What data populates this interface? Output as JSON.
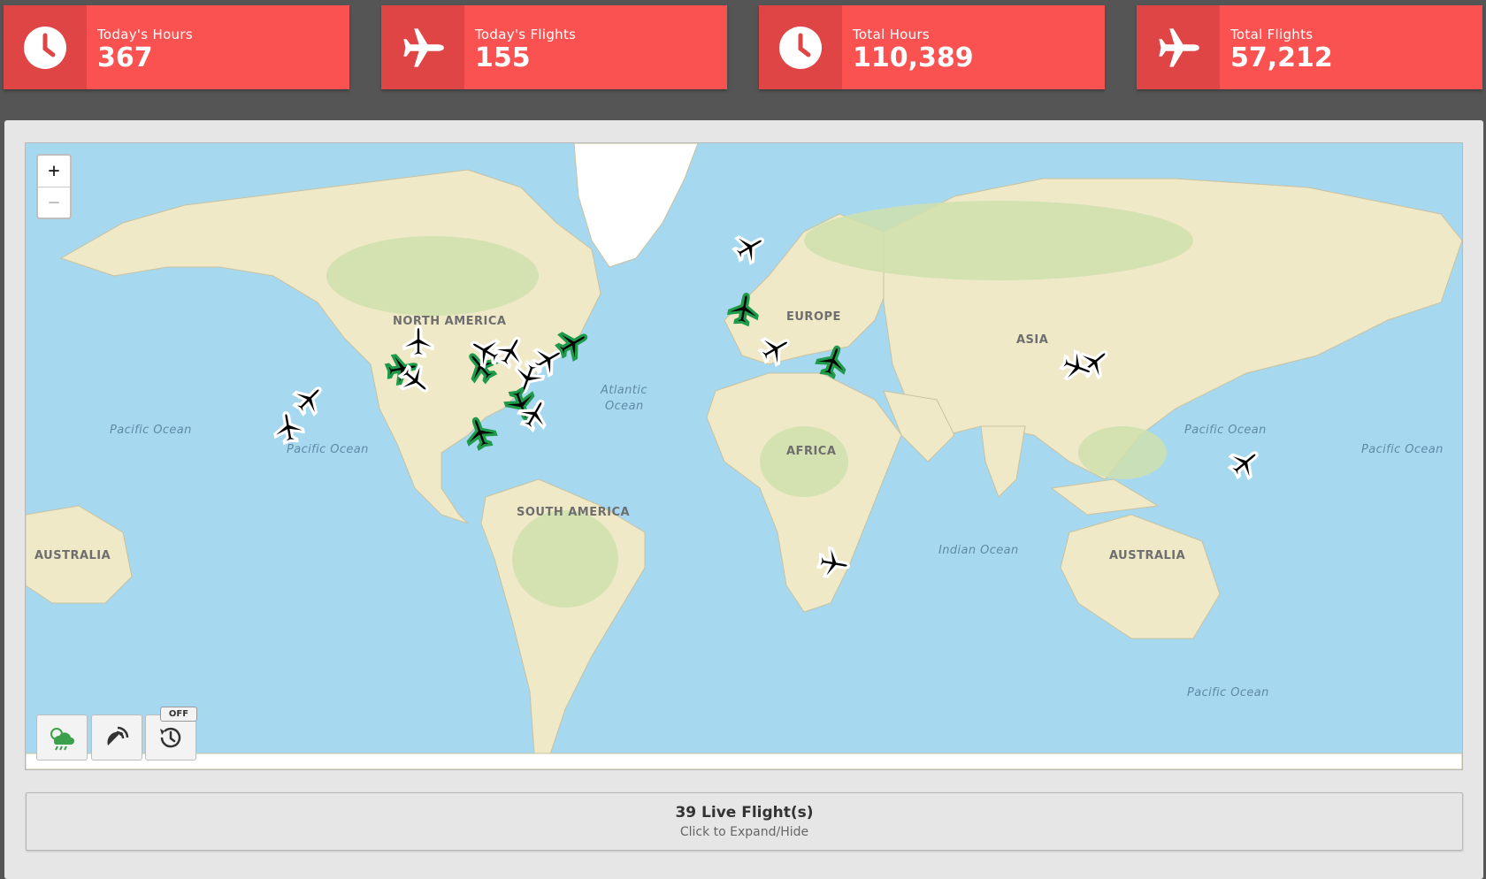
{
  "stats": [
    {
      "label": "Today's Hours",
      "value": "367",
      "icon": "clock-icon"
    },
    {
      "label": "Today's Flights",
      "value": "155",
      "icon": "plane-icon"
    },
    {
      "label": "Total Hours",
      "value": "110,389",
      "icon": "clock-icon"
    },
    {
      "label": "Total Flights",
      "value": "57,212",
      "icon": "plane-icon"
    }
  ],
  "map": {
    "labels": {
      "north_america": "NORTH AMERICA",
      "south_america": "SOUTH AMERICA",
      "europe": "EUROPE",
      "africa": "AFRICA",
      "asia": "ASIA",
      "australia_west": "AUSTRALIA",
      "australia_east": "AUSTRALIA",
      "pacific_1": "Pacific Ocean",
      "pacific_2": "Pacific Ocean",
      "pacific_3": "Pacific Ocean",
      "pacific_4": "Pacific Ocean",
      "pacific_5": "Pacific Ocean",
      "atlantic_1": "Atlantic",
      "atlantic_2": "Ocean",
      "indian": "Indian Ocean"
    },
    "zoom_in": "+",
    "zoom_out": "−",
    "replay_badge": "OFF",
    "colors": {
      "ocean": "#a6d8ef",
      "land": "#efe9c8",
      "vegetation": "#cfe0ad",
      "ice": "#ffffff",
      "plane_active": "#1f9a4a",
      "plane_idle": "#000000"
    }
  },
  "footer": {
    "title": "39 Live Flight(s)",
    "subtitle": "Click to Expand/Hide"
  }
}
